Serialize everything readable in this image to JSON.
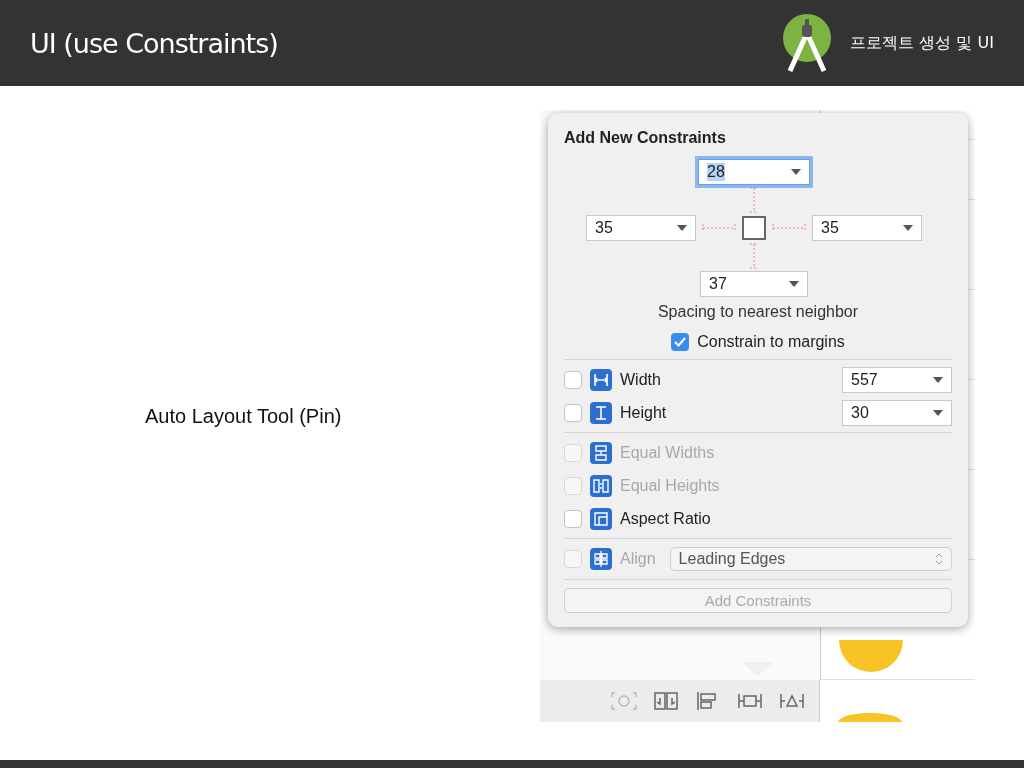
{
  "header": {
    "title": "UI (use Constraints)",
    "subtitle": "프로젝트 생성 및 UI"
  },
  "caption": "Auto Layout Tool (Pin)",
  "popover": {
    "title": "Add New Constraints",
    "top": {
      "value": "28",
      "focused": true
    },
    "left": {
      "value": "35",
      "focused": false
    },
    "right": {
      "value": "35",
      "focused": false
    },
    "bottom": {
      "value": "37",
      "focused": false
    },
    "spacing_label": "Spacing to nearest neighbor",
    "margins": {
      "label": "Constrain to margins",
      "checked": true
    },
    "groups": [
      {
        "rows": [
          {
            "kind": "value",
            "label": "Width",
            "checked": false,
            "disabled": false,
            "value": "557"
          },
          {
            "kind": "value",
            "label": "Height",
            "checked": false,
            "disabled": false,
            "value": "30"
          }
        ]
      },
      {
        "rows": [
          {
            "kind": "plain",
            "label": "Equal Widths",
            "checked": false,
            "disabled": true
          },
          {
            "kind": "plain",
            "label": "Equal Heights",
            "checked": false,
            "disabled": true
          },
          {
            "kind": "plain",
            "label": "Aspect Ratio",
            "checked": false,
            "disabled": false
          }
        ]
      },
      {
        "rows": [
          {
            "kind": "select",
            "label": "Align",
            "checked": false,
            "disabled": true,
            "value": "Leading Edges"
          }
        ]
      }
    ],
    "add_button": {
      "label": "Add Constraints",
      "disabled": true
    }
  }
}
